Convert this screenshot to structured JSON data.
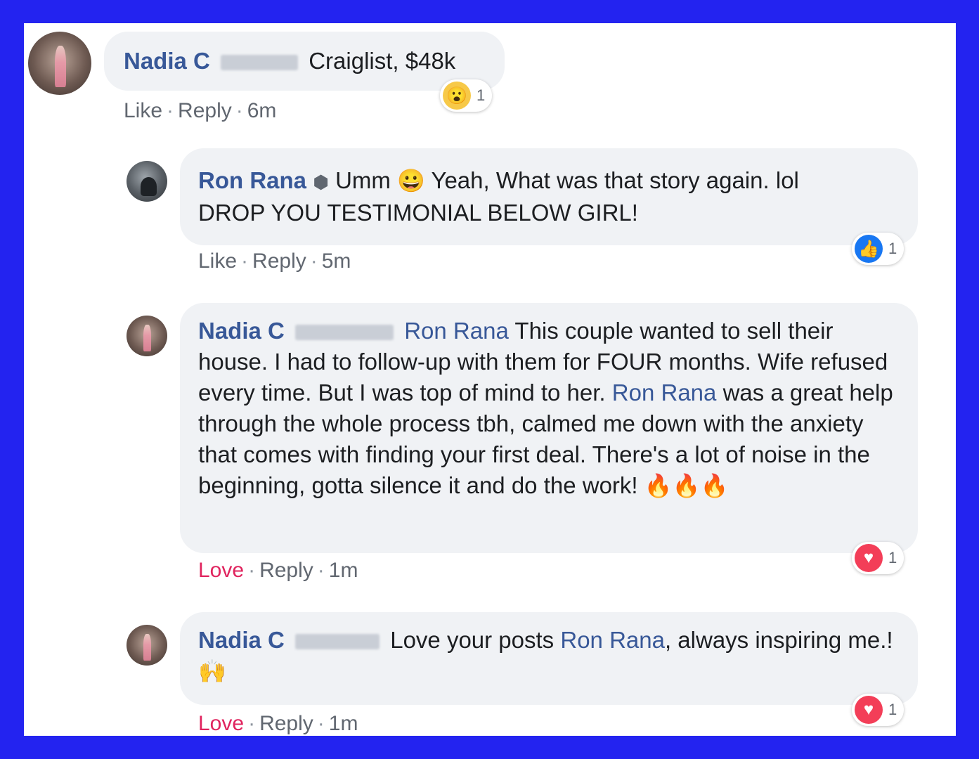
{
  "comments": [
    {
      "author": "Nadia C",
      "text": "Craiglist, $48k",
      "actions": {
        "like": "Like",
        "reply": "Reply",
        "time": "6m"
      },
      "reaction": {
        "icon": "wow-reaction-icon",
        "count": "1",
        "color": "#f7c948"
      }
    },
    {
      "author": "Ron Rana",
      "text_a": "Umm",
      "text_b": "Yeah, What was that story again. lol",
      "text_c": "DROP YOU TESTIMONIAL BELOW GIRL!",
      "actions": {
        "like": "Like",
        "reply": "Reply",
        "time": "5m"
      },
      "reaction": {
        "icon": "like-reaction-icon",
        "count": "1",
        "color": "#1877f2"
      }
    },
    {
      "author": "Nadia C",
      "mention": "Ron Rana",
      "text_a": "This couple wanted to sell their house. I had to follow-up with them for FOUR months. Wife refused every time. But I was top of mind to her.",
      "mention2": "Ron Rana",
      "text_b": "was a great help through the whole process tbh, calmed me down with the anxiety that comes with finding your first deal. There's a lot of noise in the beginning, gotta silence it and do the work!",
      "actions": {
        "like": "Love",
        "reply": "Reply",
        "time": "1m"
      },
      "reaction": {
        "icon": "love-reaction-icon",
        "count": "1",
        "color": "#f33e58"
      }
    },
    {
      "author": "Nadia C",
      "text_a": "Love your posts",
      "mention": "Ron Rana",
      "text_b": ", always inspiring me.!",
      "actions": {
        "like": "Love",
        "reply": "Reply",
        "time": "1m"
      },
      "reaction": {
        "icon": "love-reaction-icon",
        "count": "1",
        "color": "#f33e58"
      }
    }
  ],
  "colors": {
    "frame_border": "#2323f0",
    "link": "#385898",
    "love": "#e0245e",
    "bubble": "#f0f2f5"
  }
}
